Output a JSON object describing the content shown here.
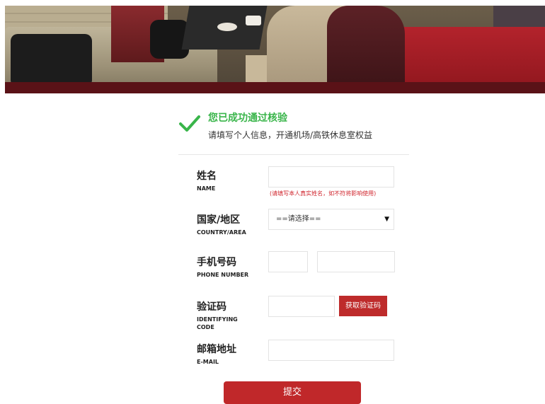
{
  "success": {
    "title": "您已成功通过核验",
    "subtitle": "请填写个人信息，开通机场/高铁休息室权益",
    "accent_color": "#39b54a",
    "icon": "check-icon"
  },
  "form": {
    "name": {
      "label_cn": "姓名",
      "label_en": "NAME",
      "value": "",
      "hint": "(请填写本人真实姓名，如不符将影响使用)"
    },
    "country": {
      "label_cn": "国家/地区",
      "label_en": "COUNTRY/AREA",
      "selected": "==请选择=="
    },
    "phone": {
      "label_cn": "手机号码",
      "label_en": "PHONE NUMBER",
      "code_value": "",
      "number_value": ""
    },
    "verify": {
      "label_cn": "验证码",
      "label_en_line1": "IDENTIFYING",
      "label_en_line2": "CODE",
      "value": "",
      "button": "获取验证码"
    },
    "email": {
      "label_cn": "邮箱地址",
      "label_en": "E-MAIL",
      "value": ""
    },
    "submit": "提交",
    "button_color": "#c0282a"
  }
}
